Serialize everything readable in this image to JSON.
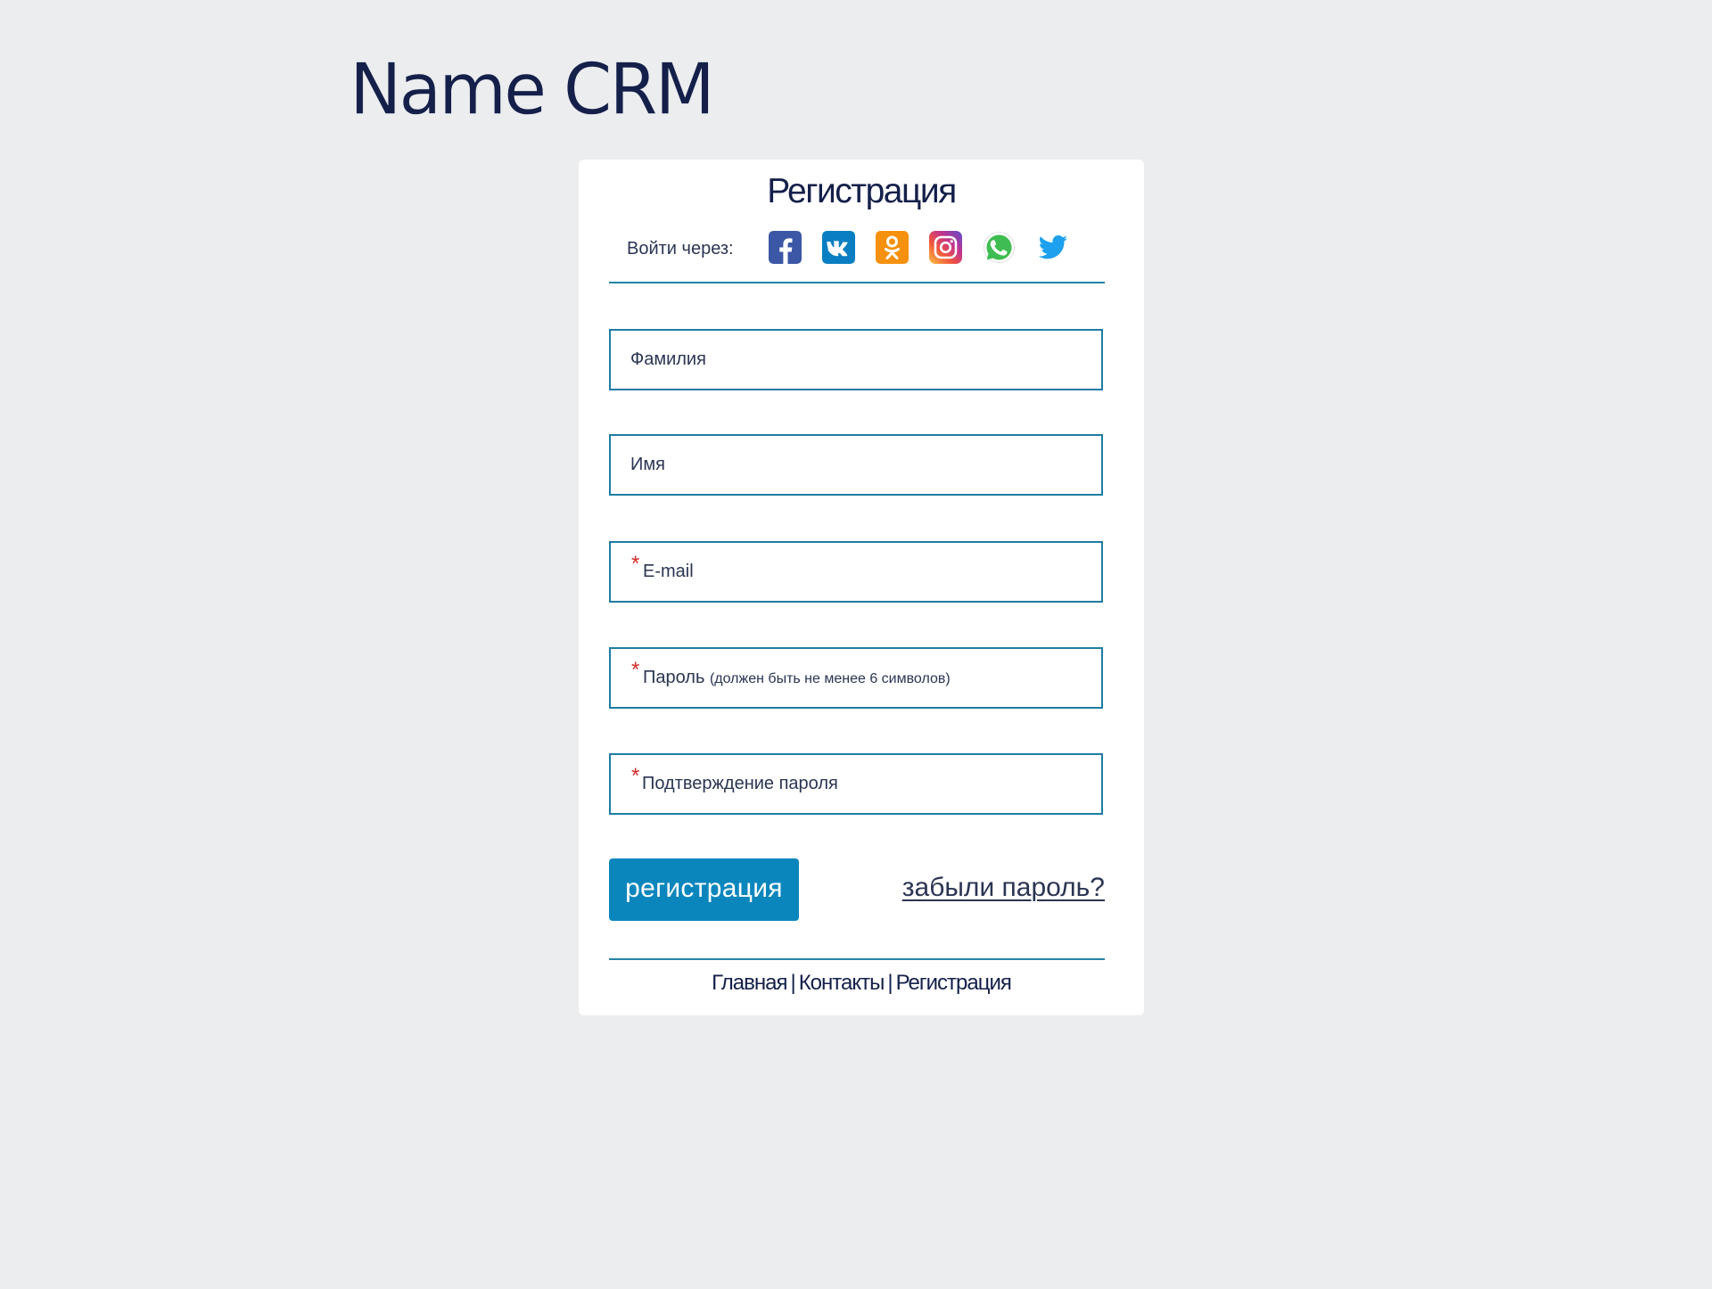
{
  "logo": {
    "text": "Name CRM"
  },
  "card": {
    "title": "Регистрация"
  },
  "social": {
    "label": "Войти через:",
    "items": [
      {
        "name": "facebook",
        "glyph": "f",
        "color": "#3b57a6"
      },
      {
        "name": "vk",
        "glyph": "vk",
        "color": "#0a7ec2"
      },
      {
        "name": "odnoklassniki",
        "glyph": "ok",
        "color": "#f5910f"
      },
      {
        "name": "instagram",
        "glyph": "camera",
        "color": "#c2348e"
      },
      {
        "name": "whatsapp",
        "glyph": "phone",
        "color": "#3fbd52"
      },
      {
        "name": "twitter",
        "glyph": "bird",
        "color": "#1da0ee"
      }
    ]
  },
  "form": {
    "surname_label": "Фамилия",
    "name_label": "Имя",
    "email_label": "E-mail",
    "password_label": "Пароль",
    "password_hint": "(должен быть не менее 6 символов)",
    "password_confirm_label": "Подтверждение пароля",
    "required_mark": "*",
    "submit_label": "регистрация",
    "forgot_label": "забыли пароль?"
  },
  "footer": {
    "links": [
      "Главная",
      "Контакты",
      "Регистрация"
    ],
    "separator": "|"
  },
  "colors": {
    "background": "#ecedef",
    "accent": "#0a86bd",
    "border": "#1e7da3",
    "required": "#d52b2b",
    "text": "#14204a"
  }
}
